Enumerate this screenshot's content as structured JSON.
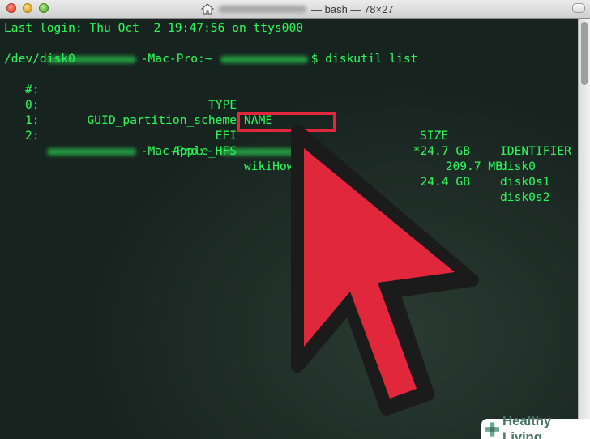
{
  "window": {
    "title": "— bash — 78×27"
  },
  "terminal": {
    "last_login": "Last login: Thu Oct  2 19:47:56 on ttys000",
    "prompt_host": "-Mac-Pro:~",
    "command": "$ diskutil list",
    "device": "/dev/disk0",
    "headers": {
      "num": "#:",
      "type": "TYPE",
      "name": "NAME",
      "size": "SIZE",
      "identifier": "IDENTIFIER"
    },
    "partitions": [
      {
        "num": "0:",
        "type": "GUID_partition_scheme",
        "name": "",
        "size": "*24.7 GB",
        "identifier": "disk0"
      },
      {
        "num": "1:",
        "type": "EFI",
        "name": "",
        "size": "209.7 MB",
        "identifier": "disk0s1"
      },
      {
        "num": "2:",
        "type": "Apple_HFS",
        "name": "wikiHow data",
        "size": "24.4 GB",
        "identifier": "disk0s2"
      }
    ],
    "prompt_end": "$"
  },
  "overlay": {
    "highlight_color": "#e0273b",
    "arrow_color": "#e0273b"
  },
  "logo": {
    "text": "Healthy Living",
    "icon": "plus-cross-icon"
  }
}
